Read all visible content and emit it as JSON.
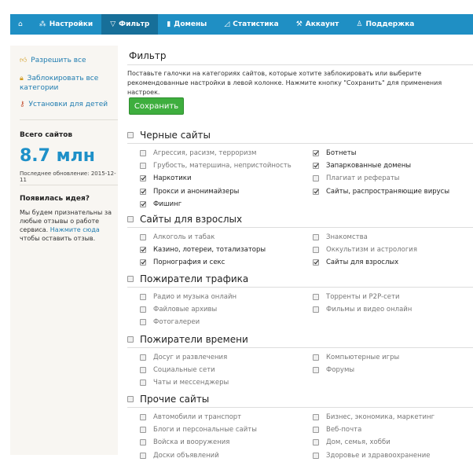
{
  "nav": {
    "items": [
      {
        "label": "",
        "icon": "home-icon"
      },
      {
        "label": "Настройки",
        "icon": "settings-icon"
      },
      {
        "label": "Фильтр",
        "icon": "filter-icon",
        "active": true
      },
      {
        "label": "Домены",
        "icon": "document-icon"
      },
      {
        "label": "Статистика",
        "icon": "chart-icon"
      },
      {
        "label": "Аккаунт",
        "icon": "wrench-icon"
      },
      {
        "label": "Поддержка",
        "icon": "support-icon"
      }
    ]
  },
  "sidebar": {
    "allow_all": "Разрешить все",
    "block_all": "Заблокировать все категории",
    "kids": "Установки для детей",
    "total_label": "Всего сайтов",
    "total_value": "8.7 млн",
    "updated_label": "Последнее обновление:",
    "updated_date": "2015-12-11",
    "idea_title": "Появилась идея?",
    "idea_text_1": "Мы будем признательны за любые отзывы о работе сервиса.",
    "idea_link": "Нажмите сюда",
    "idea_text_2": "чтобы оставить отзыв."
  },
  "main": {
    "title": "Фильтр",
    "description": "Поставьте галочки на категориях сайтов, которые хотите заблокировать или выберите рекомендованные настройки в левой колонке. Нажмите кнопку \"Сохранить\" для применения настроек.",
    "save_label": "Сохранить"
  },
  "groups": [
    {
      "title": "Черные сайты",
      "left": [
        {
          "label": "Агрессия, расизм, терроризм",
          "checked": false
        },
        {
          "label": "Грубость, матершина, непристойность",
          "checked": false
        },
        {
          "label": "Наркотики",
          "checked": true
        },
        {
          "label": "Прокси и анонимайзеры",
          "checked": true
        },
        {
          "label": "Фишинг",
          "checked": true
        }
      ],
      "right": [
        {
          "label": "Ботнеты",
          "checked": true
        },
        {
          "label": "Запаркованные домены",
          "checked": true
        },
        {
          "label": "Плагиат и рефераты",
          "checked": false
        },
        {
          "label": "Сайты, распространяющие вирусы",
          "checked": true
        }
      ]
    },
    {
      "title": "Сайты для взрослых",
      "left": [
        {
          "label": "Алкоголь и табак",
          "checked": false
        },
        {
          "label": "Казино, лотереи, тотализаторы",
          "checked": true
        },
        {
          "label": "Порнография и секс",
          "checked": true
        }
      ],
      "right": [
        {
          "label": "Знакомства",
          "checked": false
        },
        {
          "label": "Оккультизм и астрология",
          "checked": false
        },
        {
          "label": "Сайты для взрослых",
          "checked": true
        }
      ]
    },
    {
      "title": "Пожиратели трафика",
      "left": [
        {
          "label": "Радио и музыка онлайн",
          "checked": false
        },
        {
          "label": "Файловые архивы",
          "checked": false
        },
        {
          "label": "Фотогалереи",
          "checked": false
        }
      ],
      "right": [
        {
          "label": "Торренты и P2P-сети",
          "checked": false
        },
        {
          "label": "Фильмы и видео онлайн",
          "checked": false
        }
      ]
    },
    {
      "title": "Пожиратели времени",
      "left": [
        {
          "label": "Досуг и развлечения",
          "checked": false
        },
        {
          "label": "Социальные сети",
          "checked": false
        },
        {
          "label": "Чаты и мессенджеры",
          "checked": false
        }
      ],
      "right": [
        {
          "label": "Компьютерные игры",
          "checked": false
        },
        {
          "label": "Форумы",
          "checked": false
        }
      ]
    },
    {
      "title": "Прочие сайты",
      "left": [
        {
          "label": "Автомобили и транспорт",
          "checked": false
        },
        {
          "label": "Блоги и персональные сайты",
          "checked": false
        },
        {
          "label": "Войска и вооружения",
          "checked": false
        },
        {
          "label": "Доски объявлений",
          "checked": false
        }
      ],
      "right": [
        {
          "label": "Бизнес, экономика, маркетинг",
          "checked": false
        },
        {
          "label": "Веб-почта",
          "checked": false
        },
        {
          "label": "Дом, семья, хобби",
          "checked": false
        },
        {
          "label": "Здоровье и здравоохранение",
          "checked": false
        }
      ]
    }
  ]
}
